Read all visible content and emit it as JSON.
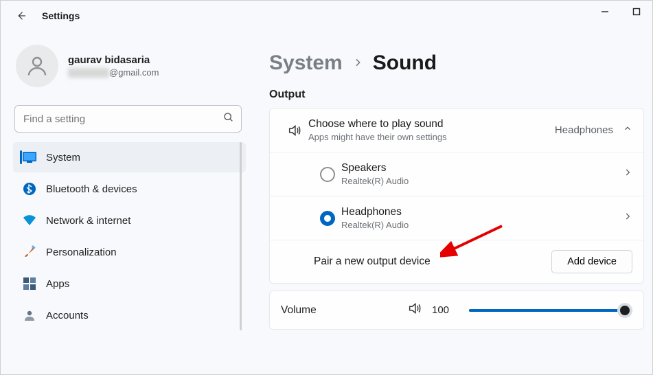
{
  "window": {
    "title": "Settings"
  },
  "user": {
    "name": "gaurav bidasaria",
    "email_suffix": "@gmail.com"
  },
  "search": {
    "placeholder": "Find a setting"
  },
  "sidebar": {
    "items": [
      {
        "label": "System"
      },
      {
        "label": "Bluetooth & devices"
      },
      {
        "label": "Network & internet"
      },
      {
        "label": "Personalization"
      },
      {
        "label": "Apps"
      },
      {
        "label": "Accounts"
      }
    ]
  },
  "header": {
    "parent": "System",
    "current": "Sound"
  },
  "output": {
    "label": "Output",
    "choose": {
      "title": "Choose where to play sound",
      "subtitle": "Apps might have their own settings",
      "current": "Headphones"
    },
    "devices": [
      {
        "name": "Speakers",
        "driver": "Realtek(R) Audio"
      },
      {
        "name": "Headphones",
        "driver": "Realtek(R) Audio"
      }
    ],
    "pair": {
      "label": "Pair a new output device",
      "button": "Add device"
    }
  },
  "volume": {
    "label": "Volume",
    "value": "100",
    "percent": 100
  }
}
